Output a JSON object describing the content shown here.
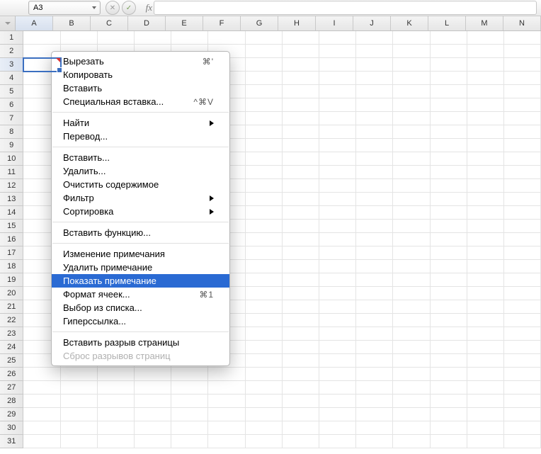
{
  "cell_ref": "A3",
  "cols": [
    "A",
    "B",
    "C",
    "D",
    "E",
    "F",
    "G",
    "H",
    "I",
    "J",
    "K",
    "L",
    "M",
    "N"
  ],
  "rows": 31,
  "sel_col": 0,
  "sel_row": 2,
  "menu": [
    {
      "t": "item",
      "label": "Вырезать",
      "shortcut": "⌘'"
    },
    {
      "t": "item",
      "label": "Копировать"
    },
    {
      "t": "item",
      "label": "Вставить"
    },
    {
      "t": "item",
      "label": "Специальная вставка...",
      "shortcut": "^⌘V"
    },
    {
      "t": "sep"
    },
    {
      "t": "item",
      "label": "Найти",
      "submenu": true
    },
    {
      "t": "item",
      "label": "Перевод..."
    },
    {
      "t": "sep"
    },
    {
      "t": "item",
      "label": "Вставить..."
    },
    {
      "t": "item",
      "label": "Удалить..."
    },
    {
      "t": "item",
      "label": "Очистить содержимое"
    },
    {
      "t": "item",
      "label": "Фильтр",
      "submenu": true
    },
    {
      "t": "item",
      "label": "Сортировка",
      "submenu": true
    },
    {
      "t": "sep"
    },
    {
      "t": "item",
      "label": "Вставить функцию..."
    },
    {
      "t": "sep"
    },
    {
      "t": "item",
      "label": "Изменение примечания"
    },
    {
      "t": "item",
      "label": "Удалить примечание"
    },
    {
      "t": "item",
      "label": "Показать примечание",
      "highlight": true
    },
    {
      "t": "item",
      "label": "Формат ячеек...",
      "shortcut": "⌘1"
    },
    {
      "t": "item",
      "label": "Выбор из списка..."
    },
    {
      "t": "item",
      "label": "Гиперссылка..."
    },
    {
      "t": "sep"
    },
    {
      "t": "item",
      "label": "Вставить разрыв страницы"
    },
    {
      "t": "item",
      "label": "Сброс разрывов страниц",
      "disabled": true
    }
  ],
  "tb": {
    "cancel": "✕",
    "confirm": "✓",
    "fx": "fx"
  }
}
